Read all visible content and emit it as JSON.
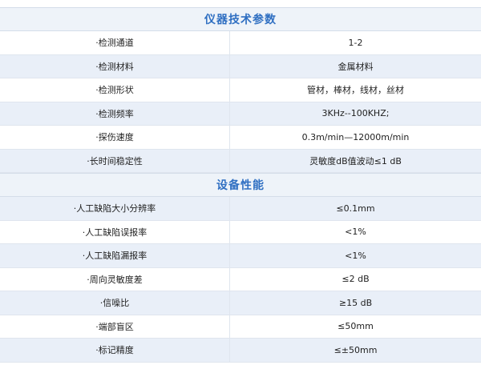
{
  "sections": [
    {
      "title": "仪器技术参数",
      "rows": [
        {
          "label": "·检测通道",
          "value": "1-2"
        },
        {
          "label": "·检测材料",
          "value": "金属材料"
        },
        {
          "label": "·检测形状",
          "value": "管材，棒材，线材，丝材"
        },
        {
          "label": "·检测频率",
          "value": "3KHz--100KHZ;"
        },
        {
          "label": "·探伤速度",
          "value": "0.3m/min—12000m/min"
        },
        {
          "label": "·长时间稳定性",
          "value": "灵敏度dB值波动≤1 dB"
        }
      ]
    },
    {
      "title": "设备性能",
      "rows": [
        {
          "label": "·人工缺陷大小分辨率",
          "value": "≤0.1mm"
        },
        {
          "label": "·人工缺陷误报率",
          "value": "<1%"
        },
        {
          "label": "·人工缺陷漏报率",
          "value": "<1%"
        },
        {
          "label": "·周向灵敏度差",
          "value": "≤2 dB"
        },
        {
          "label": "·信噪比",
          "value": "≥15 dB"
        },
        {
          "label": "·端部盲区",
          "value": "≤50mm"
        },
        {
          "label": "·标记精度",
          "value": "≤±50mm"
        }
      ]
    }
  ]
}
